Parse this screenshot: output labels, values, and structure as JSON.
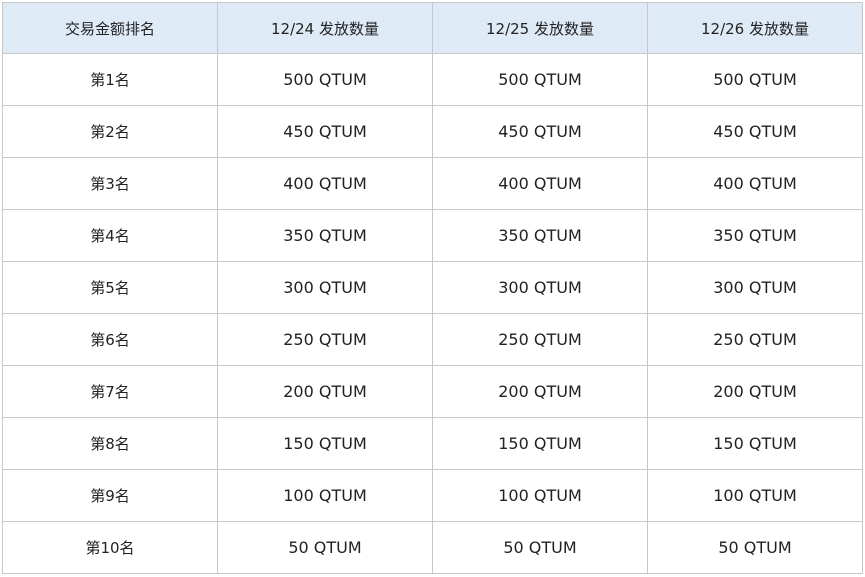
{
  "table": {
    "headers": [
      "交易金额排名",
      "12/24 发放数量",
      "12/25 发放数量",
      "12/26 发放数量"
    ],
    "rows": [
      [
        "第1名",
        "500 QTUM",
        "500 QTUM",
        "500 QTUM"
      ],
      [
        "第2名",
        "450 QTUM",
        "450 QTUM",
        "450 QTUM"
      ],
      [
        "第3名",
        "400 QTUM",
        "400 QTUM",
        "400 QTUM"
      ],
      [
        "第4名",
        "350 QTUM",
        "350 QTUM",
        "350 QTUM"
      ],
      [
        "第5名",
        "300 QTUM",
        "300 QTUM",
        "300 QTUM"
      ],
      [
        "第6名",
        "250 QTUM",
        "250 QTUM",
        "250 QTUM"
      ],
      [
        "第7名",
        "200 QTUM",
        "200 QTUM",
        "200 QTUM"
      ],
      [
        "第8名",
        "150 QTUM",
        "150 QTUM",
        "150 QTUM"
      ],
      [
        "第9名",
        "100 QTUM",
        "100 QTUM",
        "100 QTUM"
      ],
      [
        "第10名",
        "50 QTUM",
        "50 QTUM",
        "50 QTUM"
      ]
    ]
  },
  "colors": {
    "header_bg": "#deebf7",
    "border": "#c8c8c8",
    "text": "#222222"
  }
}
